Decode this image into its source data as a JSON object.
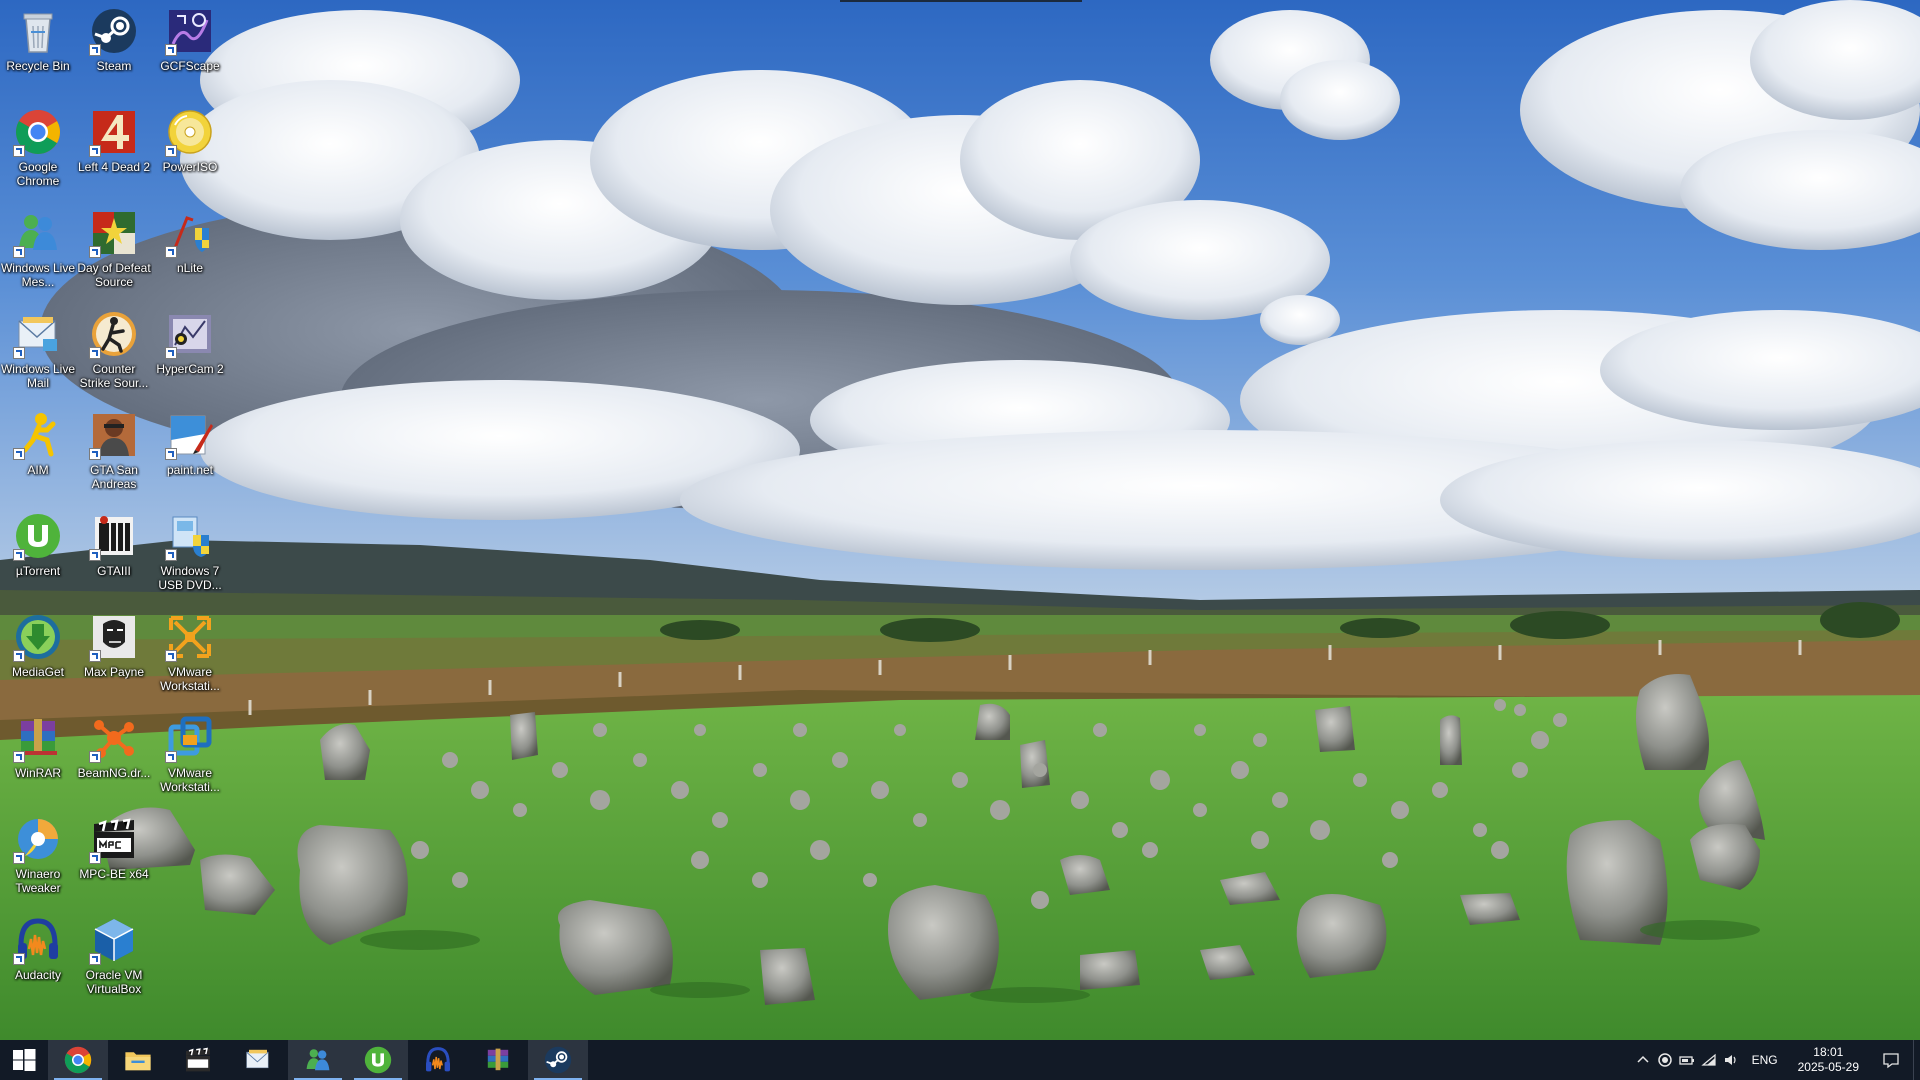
{
  "desktop": {
    "icons": [
      {
        "id": "recycle-bin",
        "label": "Recycle Bin",
        "shortcut": false
      },
      {
        "id": "google-chrome",
        "label": "Google Chrome",
        "shortcut": true
      },
      {
        "id": "windows-live-messenger",
        "label": "Windows Live Mes...",
        "shortcut": true
      },
      {
        "id": "windows-live-mail",
        "label": "Windows Live Mail",
        "shortcut": true
      },
      {
        "id": "aim",
        "label": "AIM",
        "shortcut": true
      },
      {
        "id": "utorrent",
        "label": "µTorrent",
        "shortcut": true
      },
      {
        "id": "mediaget",
        "label": "MediaGet",
        "shortcut": true
      },
      {
        "id": "winrar",
        "label": "WinRAR",
        "shortcut": true
      },
      {
        "id": "winaero-tweaker",
        "label": "Winaero Tweaker",
        "shortcut": true
      },
      {
        "id": "audacity",
        "label": "Audacity",
        "shortcut": true
      },
      {
        "id": "steam",
        "label": "Steam",
        "shortcut": true
      },
      {
        "id": "left-4-dead-2",
        "label": "Left 4 Dead 2",
        "shortcut": true
      },
      {
        "id": "day-of-defeat-source",
        "label": "Day of Defeat Source",
        "shortcut": true
      },
      {
        "id": "counter-strike-source",
        "label": "Counter Strike Sour...",
        "shortcut": true
      },
      {
        "id": "gta-san-andreas",
        "label": "GTA San Andreas",
        "shortcut": true
      },
      {
        "id": "gtaiii",
        "label": "GTAIII",
        "shortcut": true
      },
      {
        "id": "max-payne",
        "label": "Max Payne",
        "shortcut": true
      },
      {
        "id": "beamng-drive",
        "label": "BeamNG.dr...",
        "shortcut": true
      },
      {
        "id": "mpc-be-x64",
        "label": "MPC-BE x64",
        "shortcut": true
      },
      {
        "id": "oracle-vm-virtualbox",
        "label": "Oracle VM VirtualBox",
        "shortcut": true
      },
      {
        "id": "gcfscape",
        "label": "GCFScape",
        "shortcut": true
      },
      {
        "id": "poweriso",
        "label": "PowerISO",
        "shortcut": true
      },
      {
        "id": "nlite",
        "label": "nLite",
        "shortcut": true
      },
      {
        "id": "hypercam-2",
        "label": "HyperCam 2",
        "shortcut": true
      },
      {
        "id": "paint-net",
        "label": "paint.net",
        "shortcut": true
      },
      {
        "id": "windows-7-usb-dvd",
        "label": "Windows 7 USB DVD...",
        "shortcut": true
      },
      {
        "id": "vmware-workstation-1",
        "label": "VMware Workstati...",
        "shortcut": true
      },
      {
        "id": "vmware-workstation-2",
        "label": "VMware Workstati...",
        "shortcut": true
      }
    ]
  },
  "taskbar": {
    "pinned": [
      {
        "id": "chrome",
        "name": "chrome-icon",
        "active": true
      },
      {
        "id": "file-explorer",
        "name": "folder-icon",
        "active": false
      },
      {
        "id": "mpc-be",
        "name": "mpc-be-icon",
        "active": false
      },
      {
        "id": "mail",
        "name": "mail-icon",
        "active": false
      },
      {
        "id": "messenger",
        "name": "messenger-icon",
        "active": true
      },
      {
        "id": "utorrent",
        "name": "utorrent-icon",
        "active": true
      },
      {
        "id": "audacity",
        "name": "audacity-icon",
        "active": false
      },
      {
        "id": "winrar",
        "name": "winrar-icon",
        "active": false
      },
      {
        "id": "steam",
        "name": "steam-icon",
        "active": true
      }
    ],
    "tray": {
      "language": "ENG",
      "time": "18:01",
      "date": "2025-05-29"
    }
  },
  "colors": {
    "taskbar": "#121a26",
    "taskbar_active": "#2c3440",
    "running_indicator": "#7fb2f0",
    "sky": "#3a78c8",
    "grass": "#4f9a34"
  }
}
